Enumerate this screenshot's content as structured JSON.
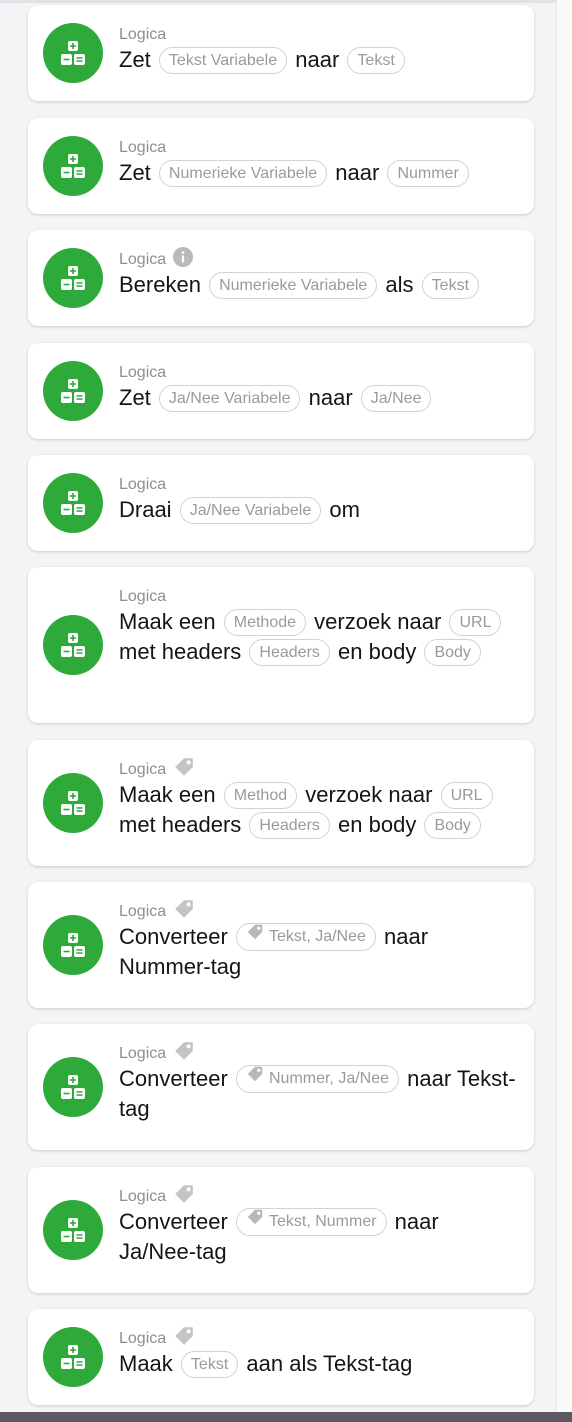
{
  "category": "Logica",
  "colors": {
    "badge": "#2eaa3b",
    "pill_border": "#d2d2d6",
    "muted": "#8e8e93"
  },
  "cards": [
    {
      "badge": "logic-icon",
      "category_mark": "none",
      "parts": [
        {
          "t": "text",
          "v": "Zet"
        },
        {
          "t": "pill",
          "v": "Tekst Variabele"
        },
        {
          "t": "text",
          "v": "naar"
        },
        {
          "t": "pill",
          "v": "Tekst"
        }
      ]
    },
    {
      "badge": "logic-icon",
      "category_mark": "none",
      "parts": [
        {
          "t": "text",
          "v": "Zet"
        },
        {
          "t": "pill",
          "v": "Numerieke Variabele"
        },
        {
          "t": "text",
          "v": "naar"
        },
        {
          "t": "pill",
          "v": "Nummer"
        }
      ]
    },
    {
      "badge": "logic-icon",
      "category_mark": "info-icon",
      "parts": [
        {
          "t": "text",
          "v": "Bereken"
        },
        {
          "t": "pill",
          "v": "Numerieke Variabele"
        },
        {
          "t": "text",
          "v": "als"
        },
        {
          "t": "pill",
          "v": "Tekst"
        }
      ]
    },
    {
      "badge": "logic-icon",
      "category_mark": "none",
      "parts": [
        {
          "t": "text",
          "v": "Zet"
        },
        {
          "t": "pill",
          "v": "Ja/Nee Variabele"
        },
        {
          "t": "text",
          "v": "naar"
        },
        {
          "t": "pill",
          "v": "Ja/Nee"
        }
      ]
    },
    {
      "badge": "logic-icon",
      "category_mark": "none",
      "parts": [
        {
          "t": "text",
          "v": "Draai"
        },
        {
          "t": "pill",
          "v": "Ja/Nee Variabele"
        },
        {
          "t": "text",
          "v": "om"
        }
      ]
    },
    {
      "badge": "logic-icon",
      "category_mark": "none",
      "parts": [
        {
          "t": "text",
          "v": "Maak een"
        },
        {
          "t": "pill",
          "v": "Methode"
        },
        {
          "t": "text",
          "v": "verzoek naar"
        },
        {
          "t": "pill",
          "v": "URL"
        },
        {
          "t": "text",
          "v": "met headers"
        },
        {
          "t": "pill",
          "v": "Headers"
        },
        {
          "t": "text",
          "v": "en body"
        },
        {
          "t": "pill",
          "v": "Body"
        }
      ]
    },
    {
      "badge": "logic-icon",
      "category_mark": "tag-icon",
      "parts": [
        {
          "t": "text",
          "v": "Maak een"
        },
        {
          "t": "pill",
          "v": "Method"
        },
        {
          "t": "text",
          "v": "verzoek naar"
        },
        {
          "t": "pill",
          "v": "URL"
        },
        {
          "t": "text",
          "v": "met headers"
        },
        {
          "t": "pill",
          "v": "Headers"
        },
        {
          "t": "text",
          "v": "en body"
        },
        {
          "t": "pill",
          "v": "Body"
        }
      ]
    },
    {
      "badge": "logic-icon",
      "category_mark": "tag-icon",
      "parts": [
        {
          "t": "text",
          "v": "Converteer"
        },
        {
          "t": "pill",
          "v": "Tekst, Ja/Nee",
          "icon": "tag-icon"
        },
        {
          "t": "text",
          "v": "naar Nummer-tag"
        }
      ]
    },
    {
      "badge": "logic-icon",
      "category_mark": "tag-icon",
      "parts": [
        {
          "t": "text",
          "v": "Converteer"
        },
        {
          "t": "pill",
          "v": "Nummer, Ja/Nee",
          "icon": "tag-icon"
        },
        {
          "t": "text",
          "v": "naar Tekst-tag"
        }
      ]
    },
    {
      "badge": "logic-icon",
      "category_mark": "tag-icon",
      "parts": [
        {
          "t": "text",
          "v": "Converteer"
        },
        {
          "t": "pill",
          "v": "Tekst, Nummer",
          "icon": "tag-icon"
        },
        {
          "t": "text",
          "v": "naar Ja/Nee-tag"
        }
      ]
    },
    {
      "badge": "logic-icon",
      "category_mark": "tag-icon",
      "parts": [
        {
          "t": "text",
          "v": "Maak"
        },
        {
          "t": "pill",
          "v": "Tekst"
        },
        {
          "t": "text",
          "v": "aan als Tekst-tag"
        }
      ]
    }
  ]
}
